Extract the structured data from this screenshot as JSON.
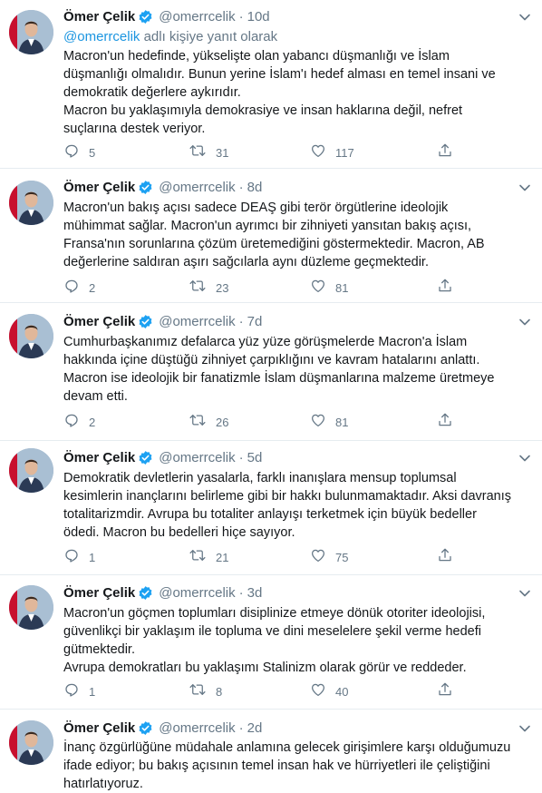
{
  "tweets": [
    {
      "name": "Ömer Çelik",
      "handle": "@omerrcelik",
      "dot": "·",
      "time": "10d",
      "replying_mention": "@omerrcelik",
      "replying_suffix": " adlı kişiye yanıt olarak",
      "lines": [
        "Macron'un hedefinde, yükselişte olan yabancı düşmanlığı ve İslam",
        "düşmanlığı olmalıdır. Bunun yerine İslam'ı hedef alması  en temel insani ve",
        "demokratik değerlere aykırıdır.",
        "Macron bu yaklaşımıyla demokrasiye ve insan haklarına değil, nefret",
        "suçlarına destek veriyor."
      ],
      "replies": "5",
      "retweets": "31",
      "likes": "117"
    },
    {
      "name": "Ömer Çelik",
      "handle": "@omerrcelik",
      "dot": "·",
      "time": "8d",
      "lines": [
        "Macron'un bakış açısı sadece DEAŞ gibi terör örgütlerine ideolojik",
        "mühimmat sağlar. Macron'un ayrımcı bir zihniyeti yansıtan bakış açısı,",
        "Fransa'nın sorunlarına çözüm üretemediğini göstermektedir. Macron, AB",
        "değerlerine saldıran aşırı sağcılarla aynı düzleme geçmektedir."
      ],
      "replies": "2",
      "retweets": "23",
      "likes": "81"
    },
    {
      "name": "Ömer Çelik",
      "handle": "@omerrcelik",
      "dot": "·",
      "time": "7d",
      "lines": [
        "Cumhurbaşkanımız defalarca yüz yüze görüşmelerde Macron'a  İslam",
        "hakkında içine düştüğü zihniyet çarpıklığını ve kavram hatalarını anlattı.",
        "Macron ise ideolojik bir fanatizmle İslam düşmanlarına malzeme üretmeye",
        "devam etti."
      ],
      "replies": "2",
      "retweets": "26",
      "likes": "81"
    },
    {
      "name": "Ömer Çelik",
      "handle": "@omerrcelik",
      "dot": "·",
      "time": "5d",
      "lines": [
        "Demokratik devletlerin yasalarla, farklı inanışlara mensup toplumsal",
        "kesimlerin inançlarını belirleme gibi bir hakkı bulunmamaktadır. Aksi davranış",
        "totalitarizmdir. Avrupa bu totaliter anlayışı terketmek için büyük bedeller",
        "ödedi. Macron bu bedelleri hiçe sayıyor."
      ],
      "replies": "1",
      "retweets": "21",
      "likes": "75"
    },
    {
      "name": "Ömer Çelik",
      "handle": "@omerrcelik",
      "dot": "·",
      "time": "3d",
      "lines": [
        "Macron'un göçmen toplumları disiplinize etmeye dönük otoriter ideolojisi,",
        "güvenlikçi bir yaklaşım ile topluma ve dini meselelere şekil verme hedefi",
        "gütmektedir.",
        "Avrupa demokratları bu yaklaşımı Stalinizm olarak görür ve reddeder."
      ],
      "replies": "1",
      "retweets": "8",
      "likes": "40"
    },
    {
      "name": "Ömer Çelik",
      "handle": "@omerrcelik",
      "dot": "·",
      "time": "2d",
      "lines": [
        "İnanç özgürlüğüne müdahale anlamına gelecek girişimlere karşı olduğumuzu",
        "ifade ediyor; bu bakış açısının temel insan hak ve hürriyetleri ile çeliştiğini",
        "hatırlatıyoruz."
      ]
    }
  ],
  "colors": {
    "verified": "#1da1f2",
    "muted": "#657786",
    "link": "#1b95e0",
    "text": "#14171a"
  },
  "icons": {
    "reply": "reply-icon",
    "retweet": "retweet-icon",
    "like": "like-icon",
    "share": "share-icon",
    "verified": "verified-badge-icon",
    "menu": "chevron-down-icon"
  }
}
